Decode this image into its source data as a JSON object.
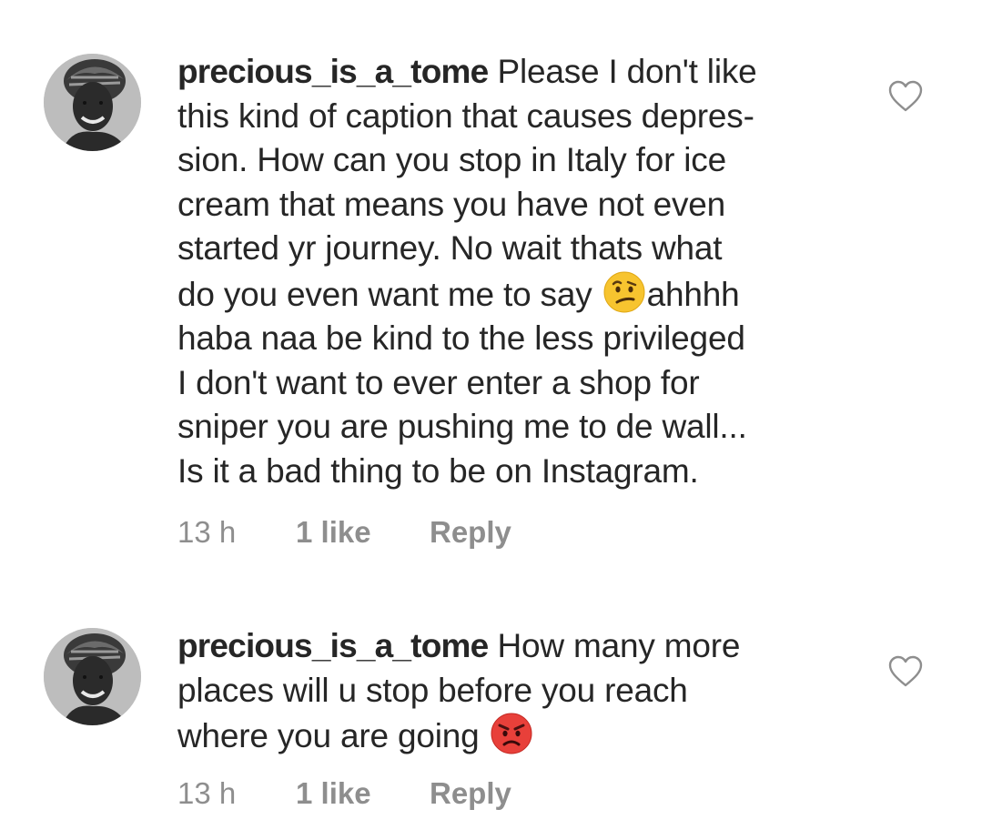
{
  "comments": [
    {
      "username": "precious_is_a_tome",
      "avatar_icon": "profile-photo-headwrap",
      "lines": [
        " Please I don't like",
        "this kind of caption that causes depres-",
        "sion. How can you stop in Italy for ice",
        "cream that means you have not even",
        "started yr journey. No wait thats what",
        "do you even want me to say ",
        "ahhhh",
        "haba naa be kind to the less privileged",
        "I don't want to ever enter a shop for",
        "sniper you are pushing me to de wall...",
        "Is it a bad thing to be on Instagram."
      ],
      "emoji": "confused-face",
      "time": "13 h",
      "likes": "1 like",
      "reply": "Reply"
    },
    {
      "username": "precious_is_a_tome",
      "avatar_icon": "profile-photo-headwrap",
      "lines": [
        " How many more",
        "places will u stop before you reach",
        "where you are going "
      ],
      "emoji": "angry-face",
      "time": "13 h",
      "likes": "1 like",
      "reply": "Reply"
    }
  ],
  "colors": {
    "text": "#262626",
    "meta": "#8e8e8e",
    "emoji_yellow": "#f7c42f",
    "emoji_red": "#e8403a"
  }
}
